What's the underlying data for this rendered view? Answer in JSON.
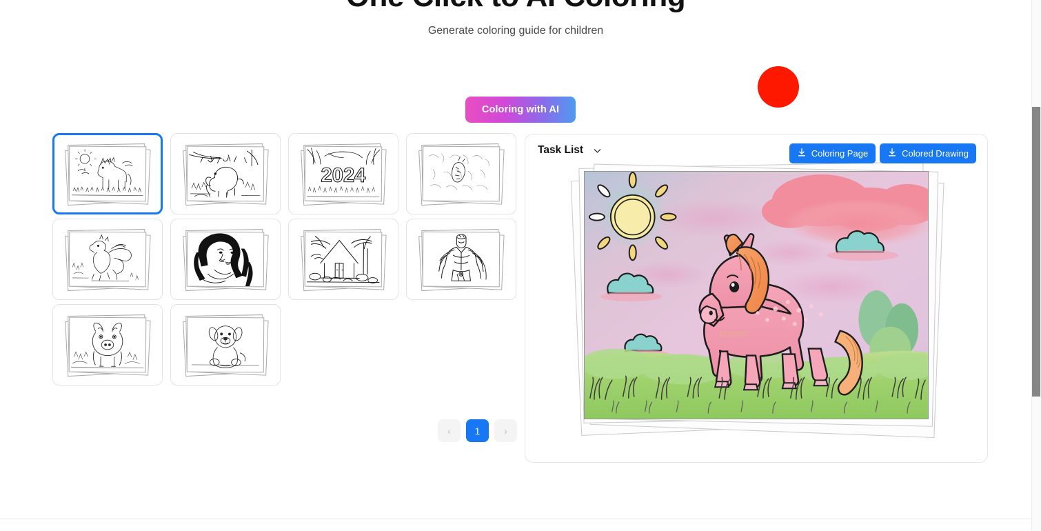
{
  "header": {
    "title": "One Click to AI Coloring",
    "subtitle": "Generate coloring guide for children"
  },
  "cta": {
    "label": "Coloring with AI"
  },
  "marker": {
    "name": "red-circle-marker",
    "color": "#ff1800"
  },
  "gallery": {
    "selected_index": 0,
    "thumbnails": [
      {
        "id": "thumb-horse",
        "alt": "Horse in meadow coloring page",
        "subject": "horse",
        "selected": true
      },
      {
        "id": "thumb-elephant",
        "alt": "Elephant under tree coloring page",
        "subject": "elephant",
        "selected": false
      },
      {
        "id": "thumb-2024",
        "alt": "2024 New Year coloring page",
        "subject": "2024",
        "label": "2024",
        "selected": false
      },
      {
        "id": "thumb-sketch",
        "alt": "Faint sketch coloring page",
        "subject": "sketch",
        "selected": false
      },
      {
        "id": "thumb-dragon",
        "alt": "Dragon coloring page",
        "subject": "dragon",
        "selected": false
      },
      {
        "id": "thumb-woman",
        "alt": "Woman portrait coloring page",
        "subject": "portrait",
        "selected": false
      },
      {
        "id": "thumb-cottage",
        "alt": "Forest cottage coloring page",
        "subject": "cottage",
        "selected": false
      },
      {
        "id": "thumb-superhero",
        "alt": "Superhero coloring page",
        "subject": "superhero",
        "selected": false
      },
      {
        "id": "thumb-pig",
        "alt": "Pig coloring page",
        "subject": "pig",
        "selected": false
      },
      {
        "id": "thumb-puppy",
        "alt": "Puppy coloring page",
        "subject": "puppy",
        "selected": false
      }
    ]
  },
  "pagination": {
    "prev_label": "‹",
    "next_label": "›",
    "current_page": "1",
    "pages": [
      "1"
    ],
    "prev_enabled": false,
    "next_enabled": false
  },
  "preview": {
    "task_list_label": "Task List",
    "download_coloring_page_label": "Coloring Page",
    "download_colored_drawing_label": "Colored Drawing",
    "image_alt": "Pink horse in a grassy meadow with sun and clouds",
    "accent_color": "#1877f2"
  }
}
